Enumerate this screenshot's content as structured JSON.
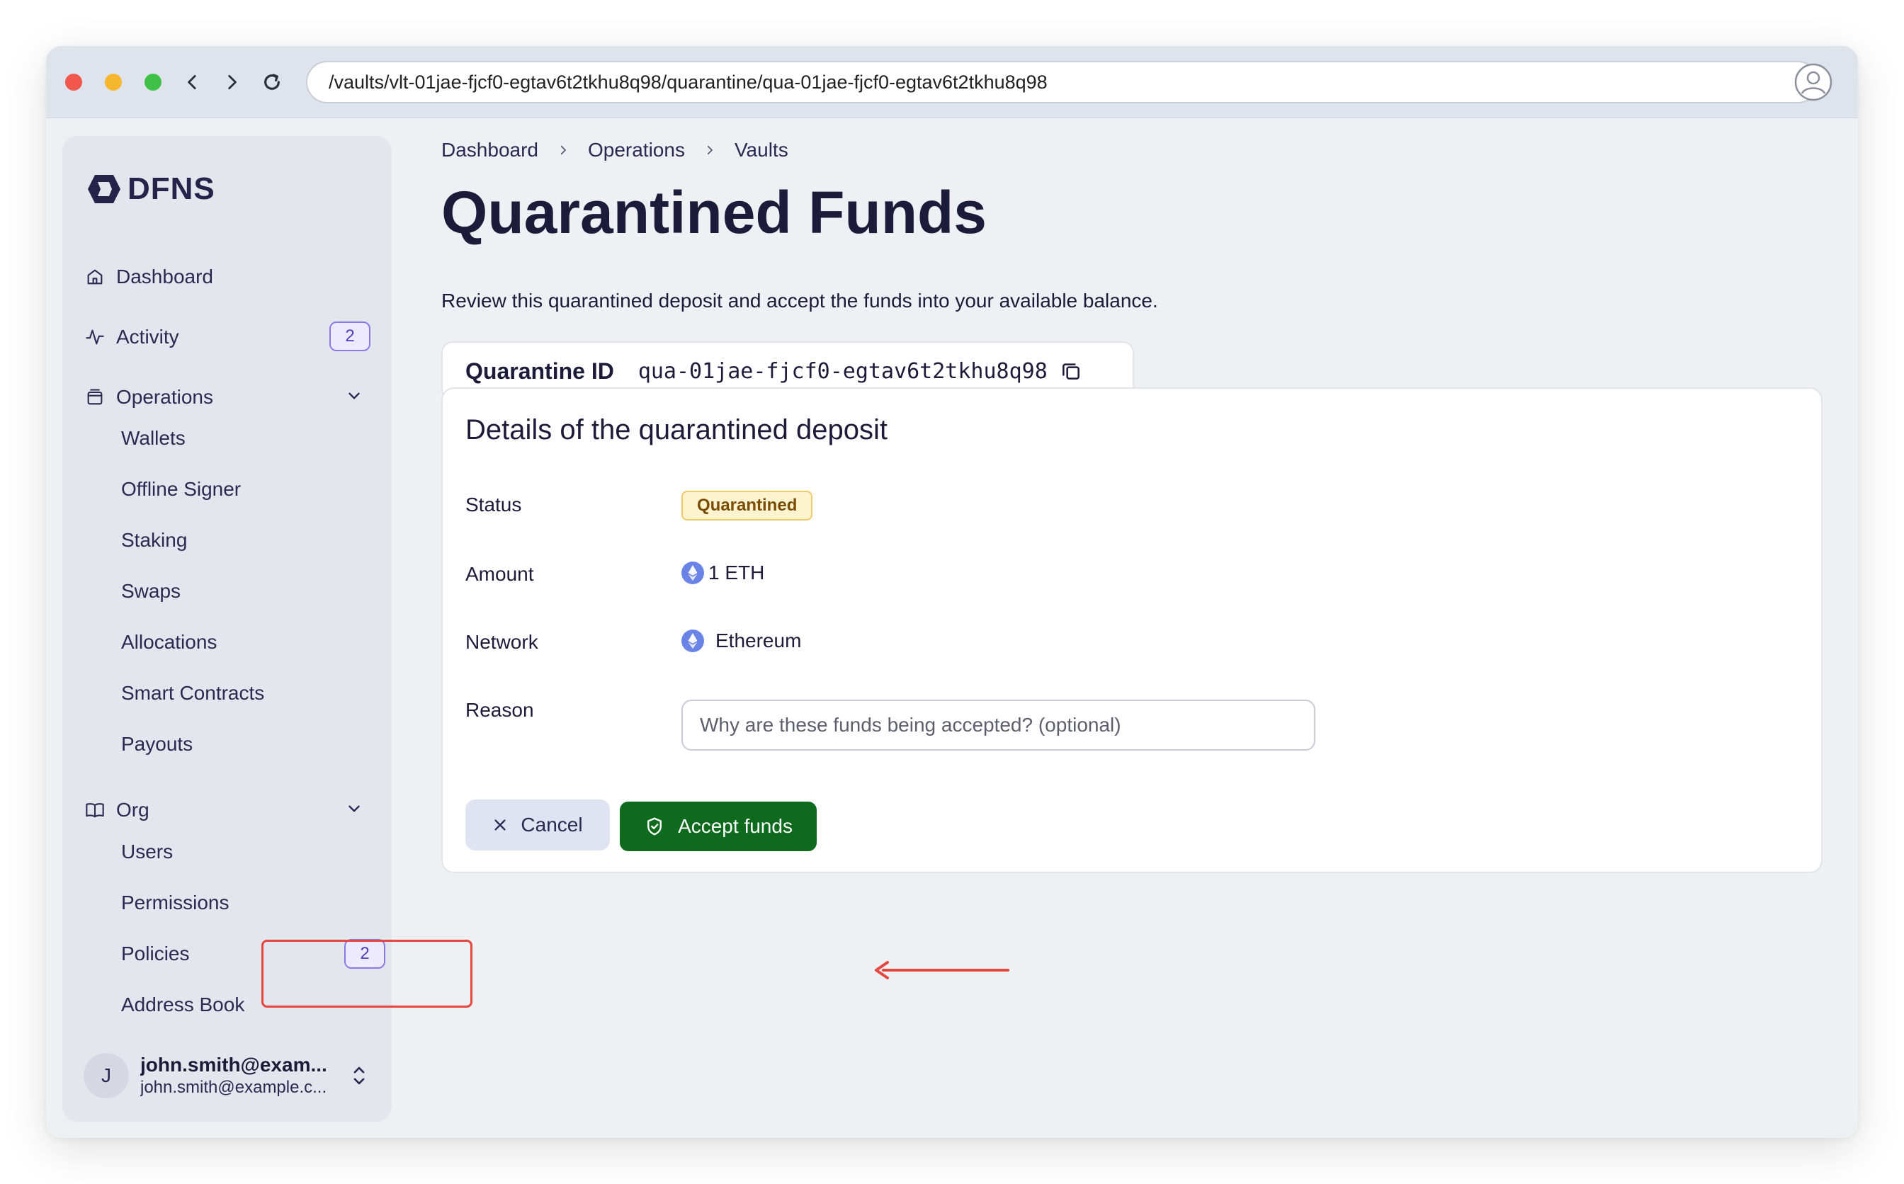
{
  "browser": {
    "url": "/vaults/vlt-01jae-fjcf0-egtav6t2tkhu8q98/quarantine/qua-01jae-fjcf0-egtav6t2tkhu8q98"
  },
  "sidebar": {
    "logo": "DFNS",
    "nav": {
      "dashboard": "Dashboard",
      "activity": "Activity",
      "activity_badge": "2",
      "operations": "Operations",
      "org": "Org"
    },
    "operations_items": [
      "Wallets",
      "Offline Signer",
      "Staking",
      "Swaps",
      "Allocations",
      "Smart Contracts",
      "Payouts"
    ],
    "org_items": [
      "Users",
      "Permissions",
      "Policies",
      "Address Book"
    ],
    "policies_badge": "2",
    "user": {
      "initial": "J",
      "name": "john.smith@exam...",
      "email": "john.smith@example.c..."
    }
  },
  "breadcrumb": [
    "Dashboard",
    "Operations",
    "Vaults"
  ],
  "page": {
    "title": "Quarantined Funds",
    "subtitle": "Review this quarantined deposit and accept the funds into your available balance."
  },
  "quarantine": {
    "label": "Quarantine ID",
    "id": "qua-01jae-fjcf0-egtav6t2tkhu8q98"
  },
  "details": {
    "title": "Details of the quarantined deposit",
    "status_label": "Status",
    "status_value": "Quarantined",
    "amount_label": "Amount",
    "amount_value": "1 ETH",
    "network_label": "Network",
    "network_value": "Ethereum",
    "reason_label": "Reason",
    "reason_placeholder": "Why are these funds being accepted? (optional)",
    "reason_value": ""
  },
  "actions": {
    "cancel": "Cancel",
    "accept": "Accept funds"
  },
  "colors": {
    "accent_purple": "#8b7be8",
    "accept_green": "#0e6a1d",
    "highlight_red": "#e5463d",
    "status_yellow": "#fdf3cf"
  }
}
